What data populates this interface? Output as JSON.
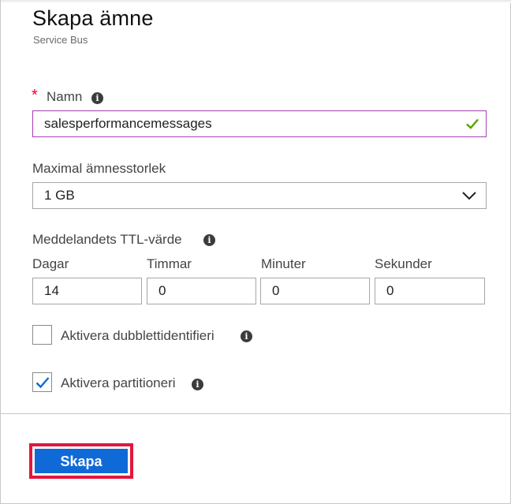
{
  "header": {
    "title": "Skapa ämne",
    "subtitle": "Service Bus"
  },
  "form": {
    "name": {
      "required_mark": "*",
      "label": "Namn",
      "value": "salesperformancemessages",
      "valid": true
    },
    "max_size": {
      "label": "Maximal ämnesstorlek",
      "selected": "1 GB"
    },
    "ttl": {
      "label": "Meddelandets TTL-värde",
      "days_label": "Dagar",
      "days_value": "14",
      "hours_label": "Timmar",
      "hours_value": "0",
      "minutes_label": "Minuter",
      "minutes_value": "0",
      "seconds_label": "Sekunder",
      "seconds_value": "0"
    },
    "duplicate_detection": {
      "label": "Aktivera dubblettidentifieri",
      "checked": false
    },
    "partitioning": {
      "label": "Aktivera partitioneri",
      "checked": true
    }
  },
  "footer": {
    "create_label": "Skapa"
  },
  "icons": {
    "info": "info-icon",
    "valid": "checkmark-icon",
    "dropdown": "chevron-down-icon"
  },
  "colors": {
    "accent": "#0f6ad8",
    "highlight": "#e3163d",
    "valid_check": "#57a300",
    "field_valid_border": "#a43fb2",
    "required": "#e3003a"
  }
}
